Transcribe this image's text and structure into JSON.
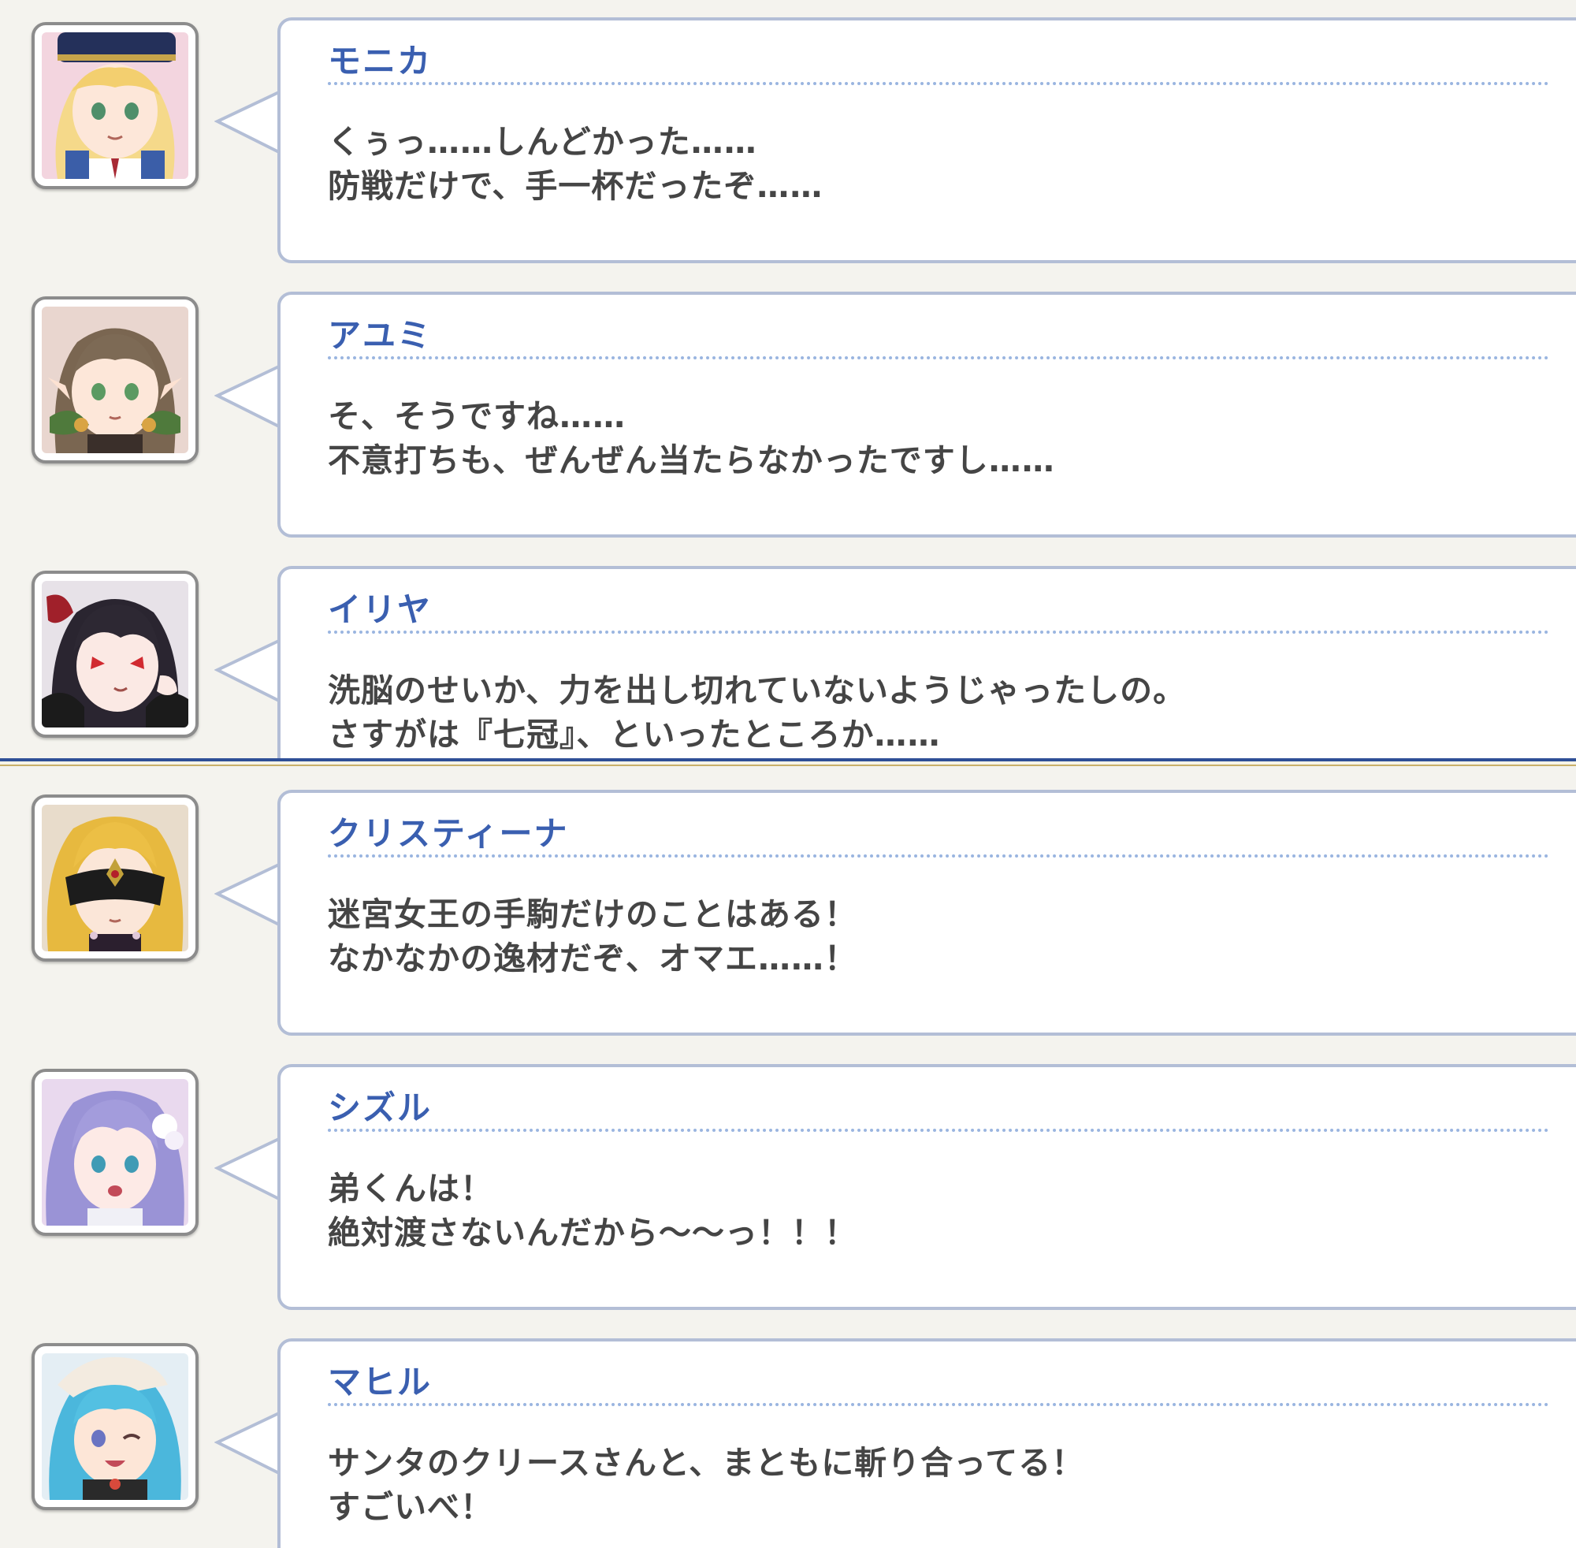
{
  "dialogue_top": [
    {
      "speaker": "モニカ",
      "lines": [
        "くぅっ……しんどかった……",
        "防戦だけで、手一杯だったぞ……"
      ],
      "avatar": "monika-portrait"
    },
    {
      "speaker": "アユミ",
      "lines": [
        "そ、そうですね……",
        "不意打ちも、ぜんぜん当たらなかったですし……"
      ],
      "avatar": "ayumi-portrait"
    },
    {
      "speaker": "イリヤ",
      "lines": [
        "洗脳のせいか、力を出し切れていないようじゃったしの。",
        "さすがは『七冠』、といったところか……"
      ],
      "avatar": "ilya-portrait"
    }
  ],
  "dialogue_bottom": [
    {
      "speaker": "クリスティーナ",
      "lines": [
        "迷宮女王の手駒だけのことはある！",
        "なかなかの逸材だぞ、オマエ……！"
      ],
      "avatar": "christina-portrait"
    },
    {
      "speaker": "シズル",
      "lines": [
        "弟くんは！",
        "絶対渡さないんだから〜〜っ！！！"
      ],
      "avatar": "shizuru-portrait"
    },
    {
      "speaker": "マヒル",
      "lines": [
        "サンタのクリースさんと、まともに斬り合ってる！",
        "すごいべ！"
      ],
      "avatar": "mahiru-portrait"
    }
  ],
  "colors": {
    "background": "#f4f3ee",
    "bubble_border": "#b3bed6",
    "speaker_name": "#3a5fb0",
    "dialogue_text": "#454545",
    "divider_blue": "#2f4f97",
    "divider_gold": "#c9b06a"
  }
}
